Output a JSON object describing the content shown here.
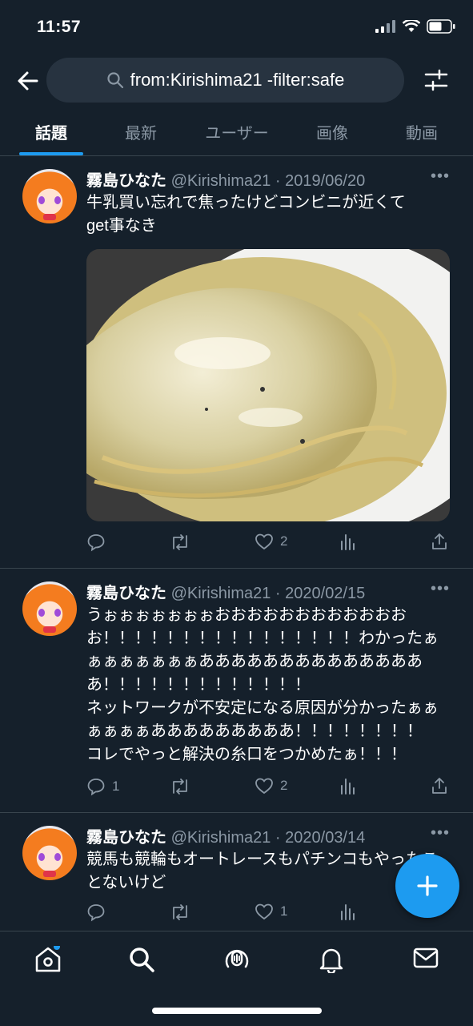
{
  "status_bar": {
    "time": "11:57"
  },
  "search": {
    "query": "from:Kirishima21 -filter:safe"
  },
  "tabs": [
    {
      "label": "話題",
      "active": true
    },
    {
      "label": "最新",
      "active": false
    },
    {
      "label": "ユーザー",
      "active": false
    },
    {
      "label": "画像",
      "active": false
    },
    {
      "label": "動画",
      "active": false
    }
  ],
  "tweets": [
    {
      "name": "霧島ひなた",
      "handle": "@Kirishima21",
      "date": "2019/06/20",
      "text": "牛乳買い忘れで焦ったけどコンビニが近くて\nget事なき",
      "replies": "",
      "retweets": "",
      "likes": "2",
      "has_media": true
    },
    {
      "name": "霧島ひなた",
      "handle": "@Kirishima21",
      "date": "2020/02/15",
      "text": "うぉぉぉぉぉぉぉおおおおおおおおおおおおお！！！！！！！！！！！！！！！！わかったぁぁぁぁぁぁぁぁあああああああああああああああ！！！！！！！！！！！！！\nネットワークが不安定になる原因が分かったぁぁぁぁぁぁあああああああああ！！！！！！！！\nコレでやっと解決の糸口をつかめたぁ！！！",
      "replies": "1",
      "retweets": "",
      "likes": "2",
      "has_media": false
    },
    {
      "name": "霧島ひなた",
      "handle": "@Kirishima21",
      "date": "2020/03/14",
      "text": "競馬も競輪もオートレースもパチンコもやったことないけど",
      "replies": "",
      "retweets": "",
      "likes": "1",
      "has_media": false
    }
  ],
  "colors": {
    "background": "#15202b",
    "accent": "#1d9bf0",
    "muted": "#8b98a5",
    "divider": "#38444d"
  }
}
